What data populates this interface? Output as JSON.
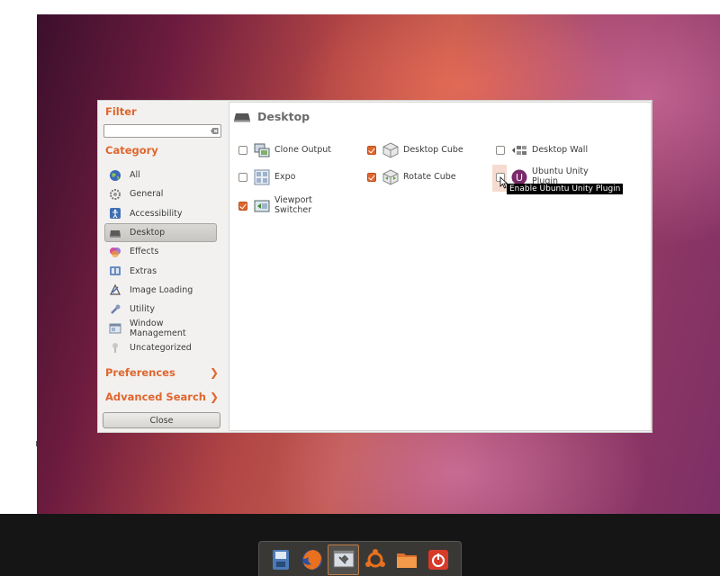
{
  "sidebar": {
    "filter_title": "Filter",
    "filter_value": "",
    "category_title": "Category",
    "categories": [
      {
        "label": "All",
        "icon": "globe-icon"
      },
      {
        "label": "General",
        "icon": "gear-icon"
      },
      {
        "label": "Accessibility",
        "icon": "accessibility-icon"
      },
      {
        "label": "Desktop",
        "icon": "desktop-icon",
        "selected": true
      },
      {
        "label": "Effects",
        "icon": "effects-icon"
      },
      {
        "label": "Extras",
        "icon": "extras-icon"
      },
      {
        "label": "Image Loading",
        "icon": "image-loading-icon"
      },
      {
        "label": "Utility",
        "icon": "utility-icon"
      },
      {
        "label": "Window Management",
        "icon": "window-management-icon"
      },
      {
        "label": "Uncategorized",
        "icon": "uncategorized-icon"
      }
    ],
    "preferences_label": "Preferences",
    "advanced_search_label": "Advanced Search",
    "close_label": "Close"
  },
  "main": {
    "header": "Desktop",
    "plugins": [
      {
        "label": "Clone Output",
        "checked": false,
        "icon": "clone-output-icon"
      },
      {
        "label": "Desktop Cube",
        "checked": true,
        "icon": "desktop-cube-icon"
      },
      {
        "label": "Desktop Wall",
        "checked": false,
        "icon": "desktop-wall-icon"
      },
      {
        "label": "Expo",
        "checked": false,
        "icon": "expo-icon"
      },
      {
        "label": "Rotate Cube",
        "checked": true,
        "icon": "rotate-cube-icon"
      },
      {
        "label": "Ubuntu Unity Plugin",
        "label_line1": "Ubuntu Unity",
        "label_line2": "Plugin",
        "checked": false,
        "icon": "ubuntu-unity-icon"
      },
      {
        "label": "Viewport Switcher",
        "label_line1": "Viewport",
        "label_line2": "Switcher",
        "checked": true,
        "icon": "viewport-switcher-icon"
      }
    ]
  },
  "tooltip": "Enable Ubuntu Unity Plugin",
  "dock": [
    {
      "name": "ccsm-launcher-icon"
    },
    {
      "name": "firefox-icon"
    },
    {
      "name": "compizconfig-icon",
      "active": true
    },
    {
      "name": "ubuntu-software-icon"
    },
    {
      "name": "files-folder-icon"
    },
    {
      "name": "power-icon"
    }
  ],
  "colors": {
    "accent": "#e0662e",
    "dock_bg": "#3a3835"
  }
}
